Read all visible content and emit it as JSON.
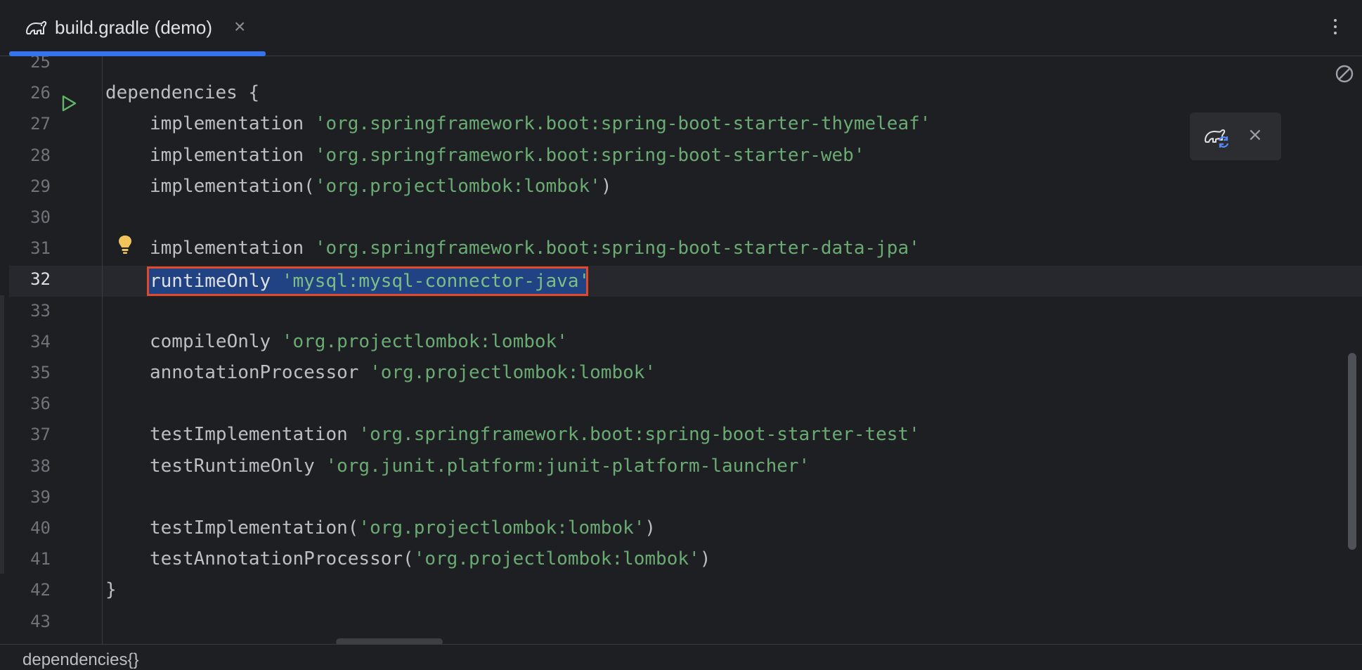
{
  "tab": {
    "title": "build.gradle (demo)",
    "close": "×"
  },
  "editor": {
    "lines": [
      {
        "n": "25",
        "indent": 0,
        "kw": "",
        "str": "",
        "post": ""
      },
      {
        "n": "26",
        "indent": 0,
        "kw": "dependencies {",
        "str": "",
        "post": ""
      },
      {
        "n": "27",
        "indent": 1,
        "kw": "implementation ",
        "str": "'org.springframework.boot:spring-boot-starter-thymeleaf'",
        "post": ""
      },
      {
        "n": "28",
        "indent": 1,
        "kw": "implementation ",
        "str": "'org.springframework.boot:spring-boot-starter-web'",
        "post": ""
      },
      {
        "n": "29",
        "indent": 1,
        "kw": "implementation(",
        "str": "'org.projectlombok:lombok'",
        "post": ")"
      },
      {
        "n": "30",
        "indent": 0,
        "kw": "",
        "str": "",
        "post": ""
      },
      {
        "n": "31",
        "indent": 1,
        "kw": "implementation ",
        "str": "'org.springframework.boot:spring-boot-starter-data-jpa'",
        "post": ""
      },
      {
        "n": "32",
        "indent": 1,
        "kw": "runtimeOnly ",
        "str": "'mysql:mysql-connector-java'",
        "post": "",
        "selected": true
      },
      {
        "n": "33",
        "indent": 0,
        "kw": "",
        "str": "",
        "post": ""
      },
      {
        "n": "34",
        "indent": 1,
        "kw": "compileOnly ",
        "str": "'org.projectlombok:lombok'",
        "post": ""
      },
      {
        "n": "35",
        "indent": 1,
        "kw": "annotationProcessor ",
        "str": "'org.projectlombok:lombok'",
        "post": ""
      },
      {
        "n": "36",
        "indent": 0,
        "kw": "",
        "str": "",
        "post": ""
      },
      {
        "n": "37",
        "indent": 1,
        "kw": "testImplementation ",
        "str": "'org.springframework.boot:spring-boot-starter-test'",
        "post": ""
      },
      {
        "n": "38",
        "indent": 1,
        "kw": "testRuntimeOnly ",
        "str": "'org.junit.platform:junit-platform-launcher'",
        "post": ""
      },
      {
        "n": "39",
        "indent": 0,
        "kw": "",
        "str": "",
        "post": ""
      },
      {
        "n": "40",
        "indent": 1,
        "kw": "testImplementation(",
        "str": "'org.projectlombok:lombok'",
        "post": ")"
      },
      {
        "n": "41",
        "indent": 1,
        "kw": "testAnnotationProcessor(",
        "str": "'org.projectlombok:lombok'",
        "post": ")"
      },
      {
        "n": "42",
        "indent": 0,
        "kw": "}",
        "str": "",
        "post": ""
      },
      {
        "n": "43",
        "indent": 0,
        "kw": "",
        "str": "",
        "post": ""
      }
    ]
  },
  "popup": {
    "close": "×"
  },
  "breadcrumb": "dependencies{}",
  "colors": {
    "accent": "#3574f0",
    "string": "#6aab73",
    "highlight_border": "#e0492d",
    "selection": "#214283"
  }
}
